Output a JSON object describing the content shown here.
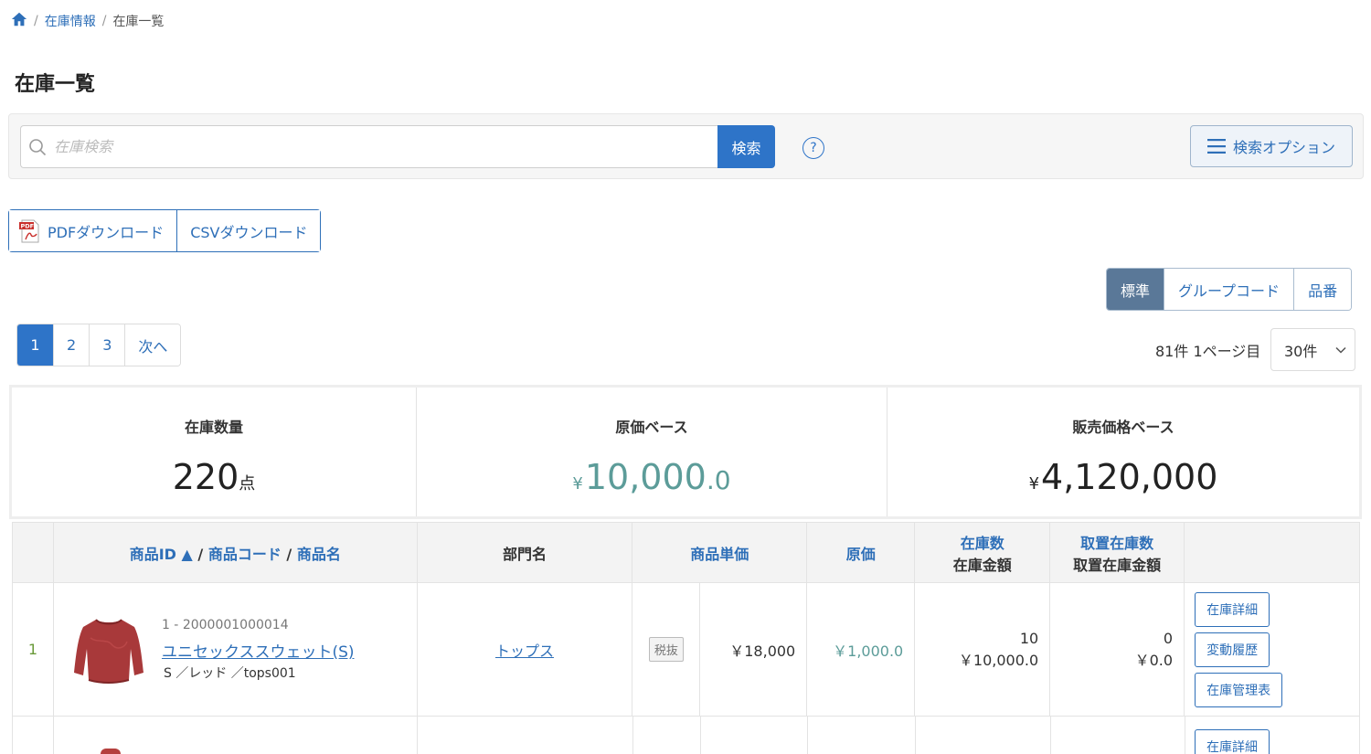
{
  "breadcrumb": {
    "items": [
      "在庫情報",
      "在庫一覧"
    ]
  },
  "page": {
    "title": "在庫一覧"
  },
  "search": {
    "placeholder": "在庫検索",
    "value": "",
    "button_label": "検索",
    "help_label": "?",
    "options_label": "検索オプション"
  },
  "downloads": {
    "pdf_label": "PDFダウンロード",
    "csv_label": "CSVダウンロード"
  },
  "view_modes": {
    "items": [
      "標準",
      "グループコード",
      "品番"
    ],
    "active": "標準"
  },
  "pagination": {
    "pages": [
      "1",
      "2",
      "3"
    ],
    "next_label": "次へ",
    "current": "1",
    "count_text": "81件 1ページ目",
    "per_page": "30件"
  },
  "summary": {
    "quantity": {
      "label": "在庫数量",
      "value": "220",
      "unit": "点"
    },
    "cost": {
      "label": "原価ベース",
      "currency": "¥",
      "value": "10,000",
      "decimal": ".0"
    },
    "price": {
      "label": "販売価格ベース",
      "currency": "¥",
      "value": "4,120,000"
    }
  },
  "table": {
    "headers": {
      "product_id": "商品ID ▲",
      "sep1": " / ",
      "product_code": "商品コード",
      "sep2": " / ",
      "product_name": "商品名",
      "department": "部門名",
      "unit_price": "商品単価",
      "cost": "原価",
      "stock_qty": "在庫数",
      "stock_amount": "在庫金額",
      "reserved_qty": "取置在庫数",
      "reserved_amount": "取置在庫金額"
    },
    "rows": [
      {
        "num": "1",
        "meta": "1 - 2000001000014",
        "name": "ユニセックススウェット(S)",
        "attrs": "S ／レッド ／tops001",
        "department": "トップス",
        "tax": "税抜",
        "unit_price": "￥18,000",
        "cost": "￥1,000.0",
        "stock_qty": "10",
        "stock_amount": "￥10,000.0",
        "reserved_qty": "0",
        "reserved_amount": "￥0.0",
        "actions": [
          "在庫詳細",
          "変動履歴",
          "在庫管理表"
        ]
      }
    ],
    "partial_row_action": "在庫詳細"
  },
  "colors": {
    "primary": "#2e74c8",
    "link": "#2e6fb8",
    "teal": "#5c9c99",
    "active_view": "#5a7898",
    "row_number": "#6a9a3a"
  }
}
